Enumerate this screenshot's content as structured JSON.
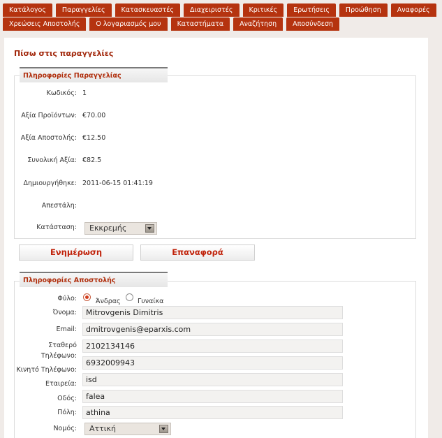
{
  "nav": {
    "row1": [
      "Κατάλογος",
      "Παραγγελίες",
      "Κατασκευαστές",
      "Διαχειριστές",
      "Κριτικές",
      "Ερωτήσεις",
      "Προώθηση",
      "Αναφορές"
    ],
    "row2": [
      "Χρεώσεις Αποστολής",
      "Ο λογαριασμός μου",
      "Καταστήματα",
      "Αναζήτηση",
      "Αποσύνδεση"
    ]
  },
  "back_link": "Πίσω στις παραγγελίες",
  "order_info": {
    "legend": "Πληροφορίες Παραγγελίας",
    "code_label": "Κωδικός:",
    "code": "1",
    "products_label": "Αξία Προϊόντων:",
    "products": "€70.00",
    "shipping_label": "Αξία Αποστολής:",
    "shipping": "€12.50",
    "total_label": "Συνολική Αξία:",
    "total": "€82.5",
    "created_label": "Δημιουργήθηκε:",
    "created": "2011-06-15 01:41:19",
    "sent_label": "Απεστάλη:",
    "status_label": "Κατάσταση:",
    "status": "Εκκρεμής"
  },
  "actions": {
    "update": "Ενημέρωση",
    "reset": "Επαναφορά"
  },
  "shipping_info": {
    "legend": "Πληροφορίες Αποστολής",
    "gender_label": "Φύλο:",
    "male": "Άνδρας",
    "female": "Γυναίκα",
    "name_label": "Όνομα:",
    "name": "Mitrovgenis Dimitris",
    "email_label": "Email:",
    "email": "dmitrovgenis@eparxis.com",
    "phone_label_1": "Σταθερό",
    "phone_label_2": "Τηλέφωνο:",
    "phone": "2102134146",
    "mobile_label": "Κινητό Τηλέφωνο:",
    "mobile": "6932009943",
    "company_label": "Εταιρεία:",
    "company": "isd",
    "street_label": "Οδός:",
    "street": "falea",
    "city_label": "Πόλη:",
    "city": "athina",
    "prefecture_label": "Νομός:",
    "prefecture": "Αττική"
  },
  "colors": {
    "nav": "#b5330f",
    "accent": "#c0220a",
    "background": "#f0ebe8"
  }
}
